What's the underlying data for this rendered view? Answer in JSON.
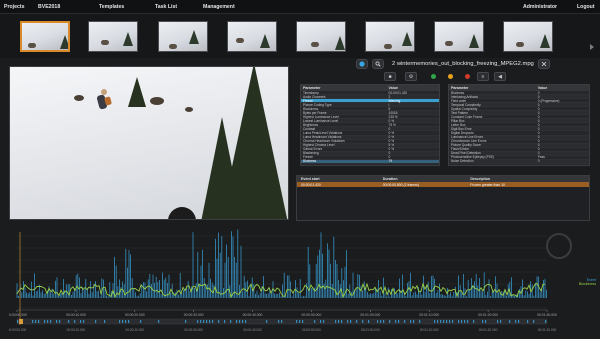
{
  "nav": {
    "projects": "Projects",
    "project_name": "BVE2018",
    "templates": "Templates",
    "task_list": "Task List",
    "management": "Management",
    "user": "Administrator",
    "logout": "Logout"
  },
  "file": {
    "title": "2 wintermemories_out_blocking_freezing_MPEG2.mpg"
  },
  "toolbar": {
    "status_colors": [
      "#2fa64a",
      "#e6a21d",
      "#d23b2b"
    ],
    "icons": [
      "play-icon",
      "search-icon",
      "stop-icon",
      "settings-icon",
      "sliders-icon",
      "export-icon",
      "audio-icon"
    ]
  },
  "params_left": {
    "headers": [
      "Parameter",
      "Value"
    ],
    "rows": [
      [
        "Timestamp",
        "00:00:01.420"
      ],
      [
        "Audio Channels",
        "2"
      ],
      [
        "Freeze",
        "Warning"
      ],
      [
        "Picture Coding Type",
        "I"
      ],
      [
        "Blockiness",
        "5"
      ],
      [
        "Bytes per Frame",
        "10018"
      ],
      [
        "Highest Luminance Level",
        "235 %"
      ],
      [
        "Lowest Luminance Level",
        "0 %"
      ],
      [
        "Brightness",
        "75 %"
      ],
      [
        "Contrast",
        "0"
      ],
      [
        "Luma Peak/Level Violations",
        "0 %"
      ],
      [
        "Luma Headroom Violations",
        "0 %"
      ],
      [
        "Chroma Headroom Violations",
        "0 %"
      ],
      [
        "Highest Chroma Level",
        "5 %"
      ],
      [
        "Gamut Errors",
        "0 %"
      ],
      [
        "Blackening",
        "0"
      ],
      [
        "Freeze",
        "0"
      ],
      [
        "Bluriness",
        "79"
      ]
    ]
  },
  "params_right": {
    "headers": [
      "Parameter",
      "Value"
    ],
    "rows": [
      [
        "Bluriness",
        "0"
      ],
      [
        "Interlacing Artifacts",
        "0"
      ],
      [
        "Field order",
        "0 (Progressive)"
      ],
      [
        "Temporal Complexity",
        "0"
      ],
      [
        "Spatial Complexity",
        "0"
      ],
      [
        "Test Pattern",
        "0"
      ],
      [
        "Constant Color Frame",
        "0"
      ],
      [
        "Pillar Box",
        "0"
      ],
      [
        "Letter Box",
        "0"
      ],
      [
        "Digit Box Error",
        "0"
      ],
      [
        "Digital Dropouts",
        "0"
      ],
      [
        "Luminance Line Errors",
        "0"
      ],
      [
        "Chrominance Line Errors",
        "0"
      ],
      [
        "Picture Quality Score",
        "0"
      ],
      [
        "Flash/Strobe",
        "0"
      ],
      [
        "Dead Pixel Detection",
        "0"
      ],
      [
        "Photosensitive Epilepsy (PSE)",
        "Pass"
      ],
      [
        "Noise Detection",
        "0"
      ]
    ]
  },
  "events": {
    "headers": [
      "Event start",
      "Duration",
      "Description"
    ],
    "rows": [
      [
        "00:00:01.420",
        "00:00:00.800 (2 frames)",
        "Frozen greater than 10"
      ]
    ]
  },
  "timeline": {
    "ticks": [
      "00:00:00.000",
      "00:00:10.000",
      "00:00:20.000",
      "00:00:30.000",
      "00:00:40.000",
      "00:00:50.000",
      "00:01:00.000",
      "00:01:10.000",
      "00:01:20.000",
      "00:01:30.000"
    ],
    "legend": [
      "Event",
      "Blockiness"
    ],
    "colors": {
      "blue": "#3aa6e0",
      "green": "#9ad14a",
      "event": "#d99a3a"
    }
  }
}
